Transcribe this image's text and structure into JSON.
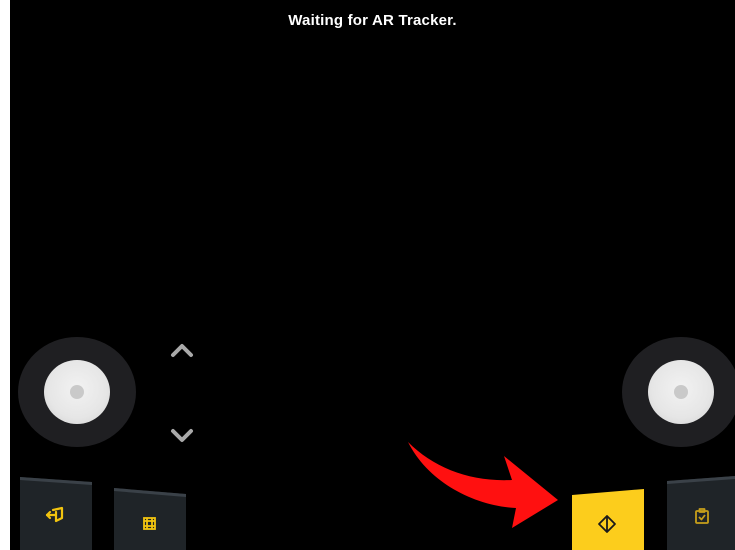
{
  "status_text": "Waiting for AR Tracker.",
  "colors": {
    "background": "#000000",
    "accent": "#fccd1c",
    "panel": "#1f2326",
    "joystick_base": "#1f1f22",
    "joystick_knob": "#e6e6e6",
    "annotation_arrow": "#ff1010"
  },
  "controls": {
    "left_joystick": {
      "icon": "joystick"
    },
    "right_joystick": {
      "icon": "joystick"
    },
    "up": {
      "icon": "chevron-up-icon"
    },
    "down": {
      "icon": "chevron-down-icon"
    },
    "toolbar": [
      {
        "name": "exit",
        "icon": "exit-icon",
        "active": false
      },
      {
        "name": "grid",
        "icon": "grid-icon",
        "active": false
      },
      {
        "name": "place",
        "icon": "place-anchor-icon",
        "active": true
      },
      {
        "name": "clipboard",
        "icon": "clipboard-check-icon",
        "active": false
      }
    ]
  }
}
